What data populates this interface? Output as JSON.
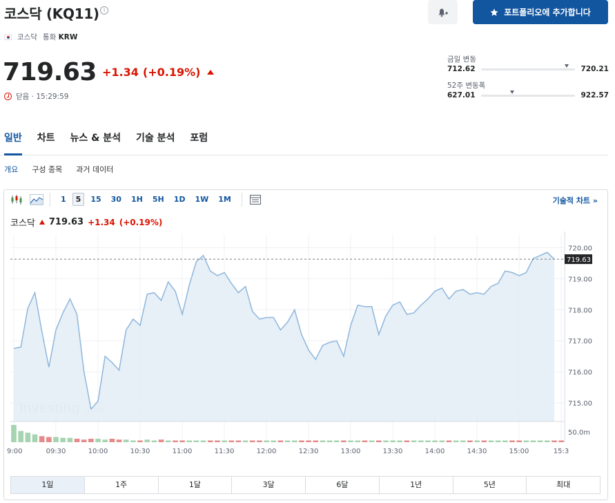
{
  "header": {
    "title": "코스닥 (KQ11)",
    "exchange": "코스닥",
    "currency_label": "통화",
    "currency": "KRW",
    "add_portfolio_label": "포트폴리오에 추가합니다"
  },
  "quote": {
    "price": "719.63",
    "change": "+1.34",
    "change_pct": "(+0.19%)",
    "status": "닫음 · 15:29:59"
  },
  "ranges": {
    "day_label": "금일 변동",
    "day_low": "712.62",
    "day_high": "720.21",
    "day_current_fraction": 0.89,
    "week52_label": "52주 변동폭",
    "week52_low": "627.01",
    "week52_high": "922.57",
    "week52_current_fraction": 0.31
  },
  "tabs": [
    "일반",
    "차트",
    "뉴스 & 분석",
    "기술 분석",
    "포럼"
  ],
  "subtabs": [
    "개요",
    "구성 종목",
    "과거 데이터"
  ],
  "chart_toolbar": {
    "intervals": [
      "1",
      "5",
      "15",
      "30",
      "1H",
      "5H",
      "1D",
      "1W",
      "1M"
    ],
    "active_interval": "5",
    "technical_link": "기술적 차트 »"
  },
  "chart_legend": {
    "name": "코스닥",
    "price": "719.63",
    "change": "+1.34",
    "change_pct": "(+0.19%)"
  },
  "range_buttons": [
    "1일",
    "1주",
    "1달",
    "3달",
    "6달",
    "1년",
    "5년",
    "최대"
  ],
  "active_range": "1일",
  "colors": {
    "accent": "#1256a0",
    "down": "#d91400",
    "line": "#8eb6dc",
    "area": "#e4edf6"
  },
  "chart_data": {
    "type": "area",
    "x": [
      "9:00",
      "9:05",
      "9:10",
      "9:15",
      "9:20",
      "9:25",
      "9:30",
      "9:35",
      "9:40",
      "9:45",
      "9:50",
      "9:55",
      "10:00",
      "10:05",
      "10:10",
      "10:15",
      "10:20",
      "10:25",
      "10:30",
      "10:35",
      "10:40",
      "10:45",
      "10:50",
      "10:55",
      "11:00",
      "11:05",
      "11:10",
      "11:15",
      "11:20",
      "11:25",
      "11:30",
      "11:35",
      "11:40",
      "11:45",
      "11:50",
      "11:55",
      "12:00",
      "12:05",
      "12:10",
      "12:15",
      "12:20",
      "12:25",
      "12:30",
      "12:35",
      "12:40",
      "12:45",
      "12:50",
      "12:55",
      "13:00",
      "13:05",
      "13:10",
      "13:15",
      "13:20",
      "13:25",
      "13:30",
      "13:35",
      "13:40",
      "13:45",
      "13:50",
      "13:55",
      "14:00",
      "14:05",
      "14:10",
      "14:15",
      "14:20",
      "14:25",
      "14:30",
      "14:35",
      "14:40",
      "14:45",
      "14:50",
      "14:55",
      "15:00",
      "15:05",
      "15:10",
      "15:15",
      "15:20",
      "15:25",
      "15:30"
    ],
    "y": [
      716.75,
      716.8,
      718.05,
      718.55,
      717.3,
      716.15,
      717.35,
      717.9,
      718.35,
      717.85,
      716.0,
      714.8,
      715.05,
      716.5,
      716.3,
      716.05,
      717.35,
      717.7,
      717.5,
      718.5,
      718.55,
      718.3,
      718.9,
      718.6,
      717.85,
      718.8,
      719.55,
      719.75,
      719.25,
      719.1,
      719.2,
      718.85,
      718.55,
      718.75,
      717.95,
      717.7,
      717.75,
      717.75,
      717.35,
      717.6,
      718.0,
      717.2,
      716.7,
      716.4,
      716.85,
      716.95,
      717.0,
      716.5,
      717.5,
      718.15,
      718.1,
      718.1,
      717.2,
      717.8,
      718.15,
      718.25,
      717.85,
      717.9,
      718.15,
      718.35,
      718.6,
      718.7,
      718.35,
      718.6,
      718.65,
      718.5,
      718.55,
      718.5,
      718.75,
      718.85,
      719.25,
      719.2,
      719.1,
      719.2,
      719.65,
      719.75,
      719.85,
      719.63
    ],
    "volume": [
      2.0,
      1.3,
      1.1,
      0.9,
      0.7,
      0.6,
      0.6,
      0.5,
      0.5,
      0.4,
      0.3,
      0.4,
      0.4,
      0.3,
      0.4,
      0.3,
      0.3,
      0.2,
      0.2,
      0.3,
      0.2,
      0.3,
      0.2,
      0.2,
      0.2,
      0.2,
      0.2,
      0.2,
      0.2,
      0.2,
      0.2,
      0.2,
      0.2,
      0.2,
      0.2,
      0.2,
      0.2,
      0.2,
      0.2,
      0.2,
      0.2,
      0.2,
      0.2,
      0.2,
      0.2,
      0.2,
      0.2,
      0.2,
      0.2,
      0.2,
      0.2,
      0.2,
      0.2,
      0.2,
      0.2,
      0.2,
      0.2,
      0.2,
      0.2,
      0.2,
      0.2,
      0.2,
      0.2,
      0.2,
      0.2,
      0.2,
      0.2,
      0.2,
      0.2,
      0.2,
      0.2,
      0.2,
      0.2,
      0.2,
      0.2,
      0.2,
      0.2,
      0.2,
      0.2
    ],
    "volume_up": [
      true,
      true,
      true,
      true,
      false,
      false,
      true,
      true,
      true,
      false,
      false,
      false,
      true,
      true,
      false,
      false,
      true,
      true,
      false,
      true,
      true,
      false,
      true,
      false,
      false,
      true,
      true,
      true,
      false,
      false,
      true,
      false,
      false,
      true,
      false,
      false,
      true,
      true,
      false,
      true,
      true,
      false,
      false,
      false,
      true,
      true,
      true,
      false,
      true,
      true,
      false,
      true,
      false,
      true,
      true,
      true,
      false,
      true,
      true,
      true,
      true,
      true,
      false,
      true,
      true,
      false,
      true,
      false,
      true,
      true,
      true,
      false,
      false,
      true,
      true,
      true,
      true,
      false
    ],
    "y_ticks": [
      "720.00",
      "719.00",
      "718.00",
      "717.00",
      "716.00",
      "715.00"
    ],
    "y_tick_values": [
      720,
      719,
      718,
      717,
      716,
      715
    ],
    "ylim": [
      714.4,
      720.3
    ],
    "x_tick_labels": [
      "9:00",
      "09:30",
      "10:00",
      "10:30",
      "11:00",
      "11:30",
      "12:00",
      "12:30",
      "13:00",
      "13:30",
      "14:00",
      "14:30",
      "15:00",
      "15:3"
    ],
    "volume_tick": "50.0m",
    "last_price_label": "719.63",
    "last_price": 719.63,
    "watermark": "Investing",
    "watermark_suffix": ".com"
  }
}
